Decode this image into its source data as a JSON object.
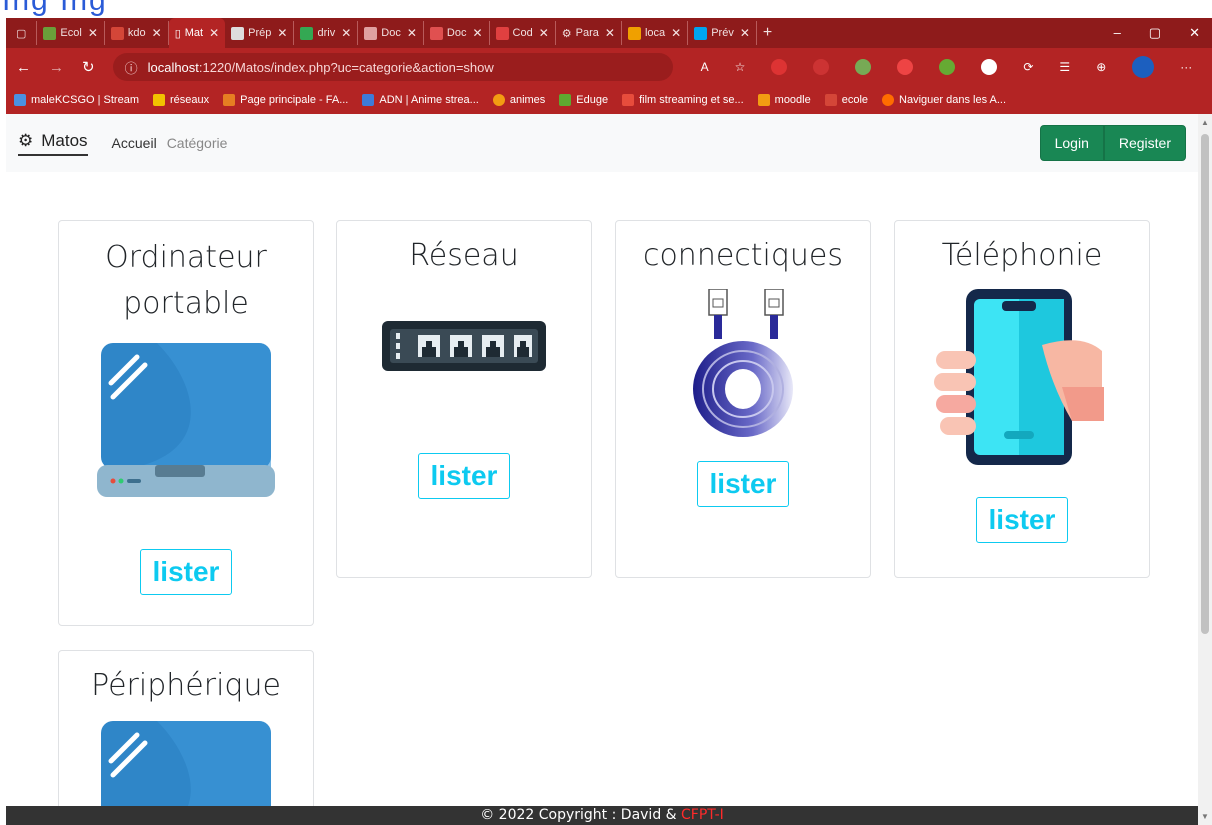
{
  "top_strip_text": "Ing  Ing",
  "tabs": [
    {
      "label": "Ecol",
      "active": false
    },
    {
      "label": "kdo",
      "active": false
    },
    {
      "label": "Mat",
      "active": true
    },
    {
      "label": "Prép",
      "active": false
    },
    {
      "label": "driv",
      "active": false
    },
    {
      "label": "Doc",
      "active": false
    },
    {
      "label": "Doc",
      "active": false
    },
    {
      "label": "Cod",
      "active": false
    },
    {
      "label": "Para",
      "active": false
    },
    {
      "label": "loca",
      "active": false
    },
    {
      "label": "Prév",
      "active": false
    }
  ],
  "address": {
    "info_icon": "ⓘ",
    "host": "localhost",
    "path": ":1220/Matos/index.php?uc=categorie&action=show"
  },
  "bookmarks": [
    {
      "label": "maleKCSGO | Stream",
      "color": "#4a90e2"
    },
    {
      "label": "réseaux",
      "color": "#f2c200"
    },
    {
      "label": "Page principale - FA...",
      "color": "#e67e22"
    },
    {
      "label": "ADN | Anime strea...",
      "color": "#3d7bd9"
    },
    {
      "label": "animes",
      "color": "#f39c12"
    },
    {
      "label": "Eduge",
      "color": "#5fa830"
    },
    {
      "label": "film streaming et se...",
      "color": "#e74c3c"
    },
    {
      "label": "moodle",
      "color": "#f39c12"
    },
    {
      "label": "ecole",
      "color": "#d44638"
    },
    {
      "label": "Naviguer dans les A...",
      "color": "#ff6d00"
    }
  ],
  "navbar": {
    "brand": "Matos",
    "home": "Accueil",
    "category": "Catégorie",
    "login": "Login",
    "register": "Register"
  },
  "cards": [
    {
      "title": "Ordinateur portable",
      "button": "lister"
    },
    {
      "title": "Réseau",
      "button": "lister"
    },
    {
      "title": "connectiques",
      "button": "lister"
    },
    {
      "title": "Téléphonie",
      "button": "lister"
    },
    {
      "title": "Périphérique",
      "button": ""
    }
  ],
  "footer": {
    "text": "© 2022 Copyright : David & ",
    "highlight": "CFPT-I"
  },
  "colors": {
    "browser_red": "#b32424",
    "tab_dark": "#8e1b1b",
    "btn_green": "#198754",
    "lister_cyan": "#0dcaf0",
    "footer_bg": "#333333"
  }
}
